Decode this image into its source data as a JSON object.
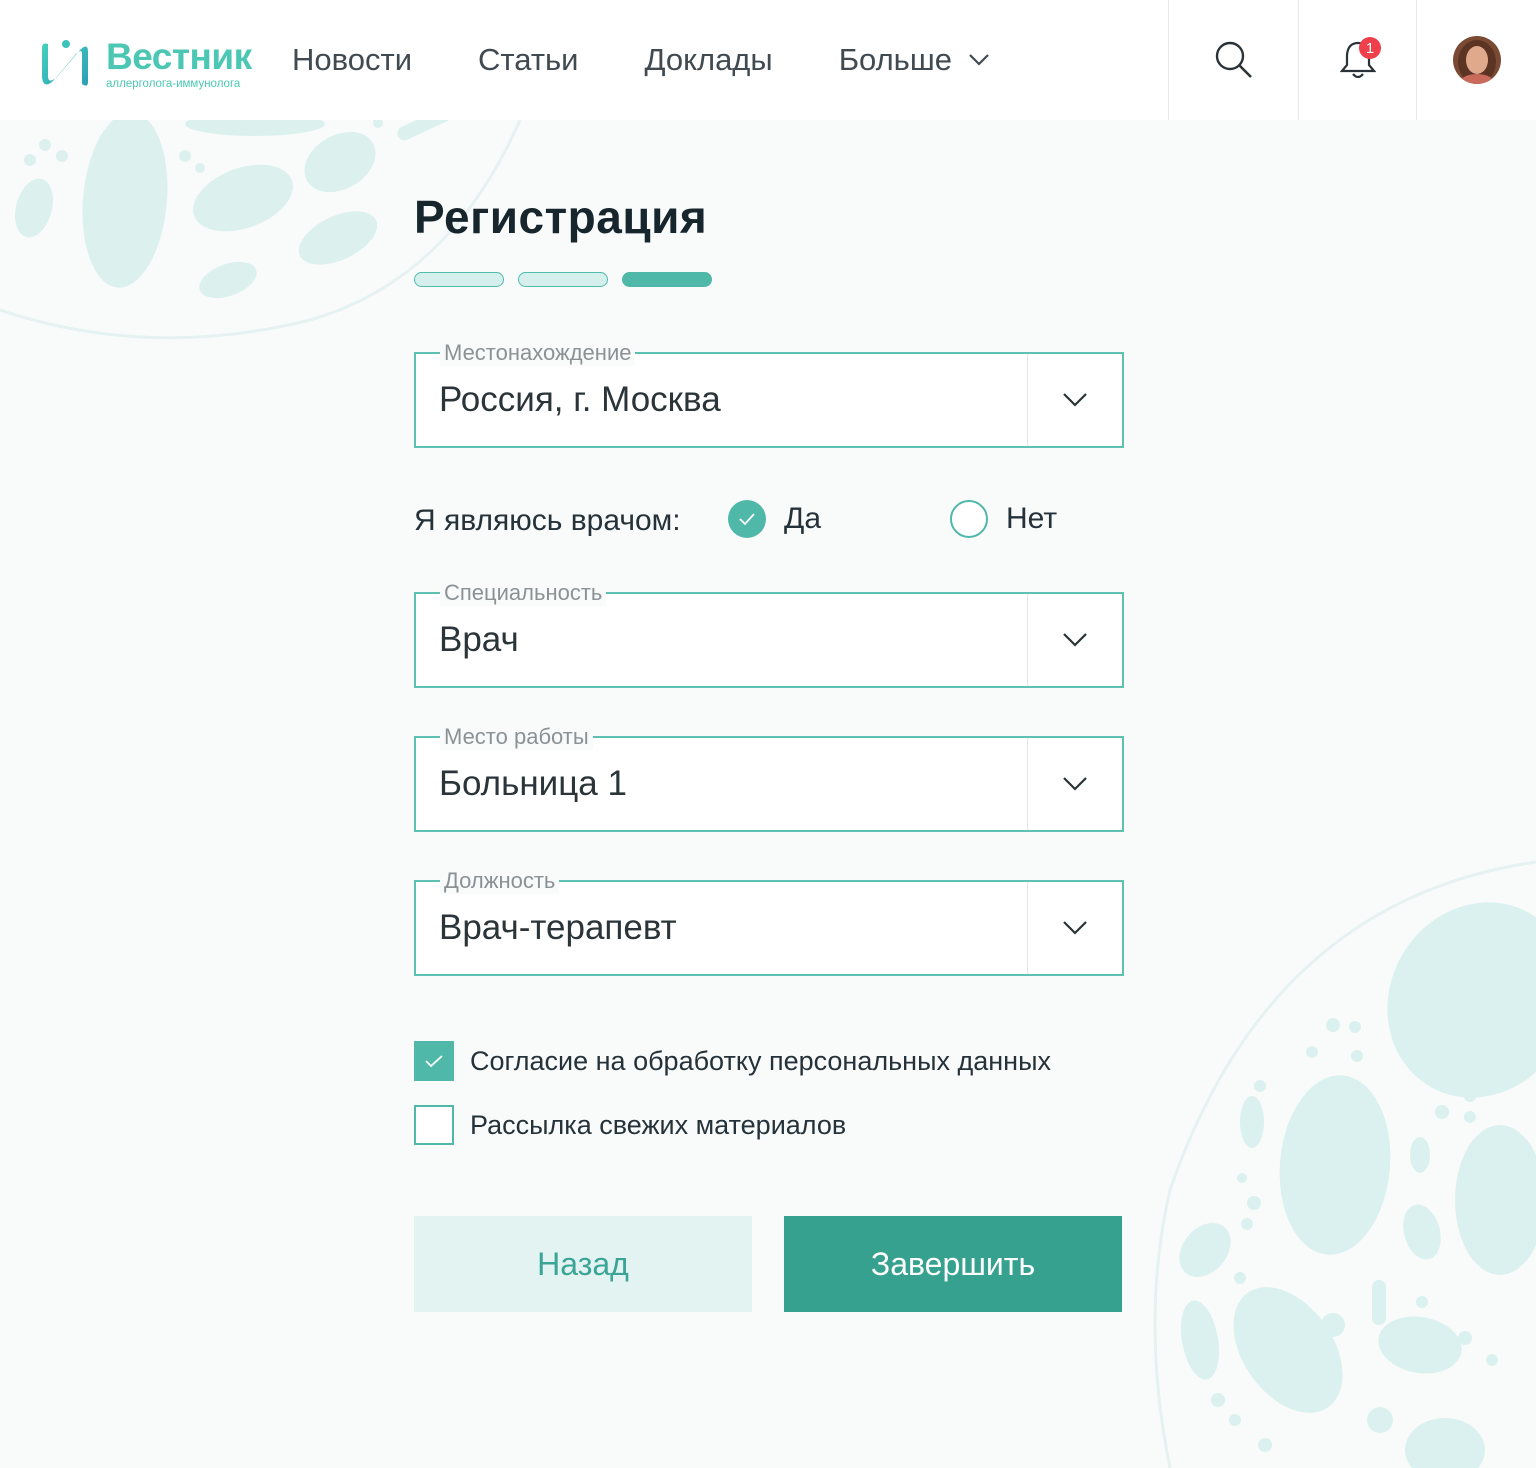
{
  "header": {
    "logo_title": "Вестник",
    "logo_subtitle": "аллерголога-иммунолога",
    "nav": [
      "Новости",
      "Статьи",
      "Доклады",
      "Больше"
    ],
    "notifications_count": "1",
    "icons": [
      "search-icon",
      "bell-icon",
      "chevron-down-icon",
      "avatar"
    ]
  },
  "page": {
    "title": "Регистрация",
    "steps_total": 3,
    "steps_active": 3
  },
  "form": {
    "location": {
      "label": "Местонахождение",
      "value": "Россия, г. Москва"
    },
    "is_doctor": {
      "label": "Я являюсь врачом:",
      "yes": "Да",
      "no": "Нет",
      "selected": "Да"
    },
    "speciality": {
      "label": "Специальность",
      "value": "Врач"
    },
    "workplace": {
      "label": "Место работы",
      "value": "Больница 1"
    },
    "position": {
      "label": "Должность",
      "value": "Врач-терапевт"
    },
    "consent": {
      "label": "Согласие на обработку персональных данных",
      "checked": true
    },
    "newsletter": {
      "label": "Рассылка свежих материалов",
      "checked": false
    }
  },
  "buttons": {
    "back": "Назад",
    "finish": "Завершить"
  },
  "colors": {
    "accent": "#4fb8a8",
    "primary_button": "#35a18e",
    "badge": "#ef3f4a"
  }
}
